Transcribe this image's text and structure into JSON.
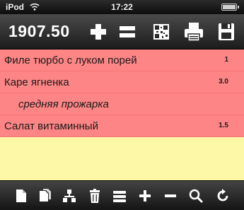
{
  "status_bar": {
    "carrier": "iPod",
    "wifi_icon": "wifi-icon",
    "time": "17:22",
    "battery_icon": "battery-icon"
  },
  "toolbar": {
    "total": "1907.50",
    "buttons": [
      {
        "name": "add-button",
        "icon": "plus-icon"
      },
      {
        "name": "equals-button",
        "icon": "equals-icon"
      },
      {
        "name": "qr-code-button",
        "icon": "qr-code-icon"
      },
      {
        "name": "print-button",
        "icon": "printer-icon"
      },
      {
        "name": "save-button",
        "icon": "floppy-disk-icon"
      }
    ]
  },
  "order": {
    "row_color": "#fe8585",
    "background_color": "#fdf8a7",
    "items": [
      {
        "name": "Филе тюрбо с луком порей",
        "qty": "1"
      },
      {
        "name": "Каре ягненка",
        "qty": "3.0"
      },
      {
        "note": "средняя прожарка"
      },
      {
        "name": "Салат витаминный",
        "qty": "1.5"
      }
    ]
  },
  "bottom_bar": {
    "buttons": [
      {
        "name": "new-document-button",
        "icon": "document-icon"
      },
      {
        "name": "copy-document-button",
        "icon": "documents-icon"
      },
      {
        "name": "hierarchy-button",
        "icon": "hierarchy-icon"
      },
      {
        "name": "delete-button",
        "icon": "trash-icon"
      },
      {
        "name": "list-button",
        "icon": "list-icon"
      },
      {
        "name": "increase-button",
        "icon": "plus-icon"
      },
      {
        "name": "decrease-button",
        "icon": "minus-icon"
      },
      {
        "name": "search-button",
        "icon": "search-icon"
      },
      {
        "name": "refresh-button",
        "icon": "refresh-icon"
      }
    ]
  }
}
